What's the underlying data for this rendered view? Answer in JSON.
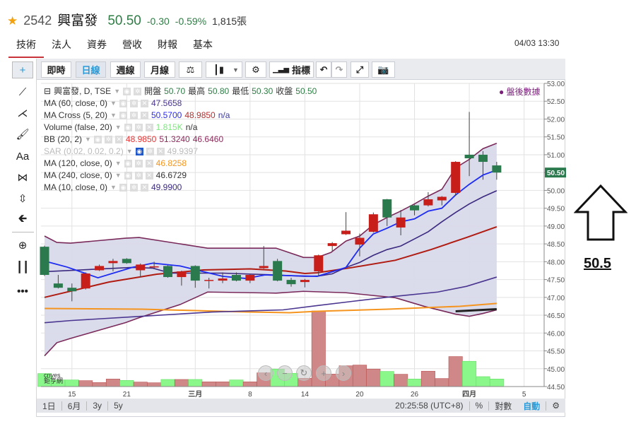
{
  "header": {
    "code": "2542",
    "name": "興富發",
    "price": "50.50",
    "change": "-0.30",
    "change_pct": "-0.59%",
    "volume": "1,815張"
  },
  "tabs": [
    {
      "label": "技術",
      "active": true
    },
    {
      "label": "法人"
    },
    {
      "label": "資券"
    },
    {
      "label": "營收"
    },
    {
      "label": "財報"
    },
    {
      "label": "基本"
    }
  ],
  "datetime": "04/03 13:30",
  "toolbar": {
    "realtime": "即時",
    "daily": "日線",
    "weekly": "週線",
    "monthly": "月線",
    "indicators": "指標"
  },
  "legend": {
    "main": {
      "label": "興富發, D, TSE",
      "open_l": "開盤",
      "open": "50.70",
      "high_l": "最高",
      "high": "50.80",
      "low_l": "最低",
      "low": "50.30",
      "close_l": "收盤",
      "close": "50.50"
    },
    "ma60": {
      "label": "MA (60, close, 0)",
      "v": "47.5658"
    },
    "macross": {
      "label": "MA Cross (5, 20)",
      "v1": "50.5700",
      "v2": "48.9850",
      "v3": "n/a"
    },
    "volume": {
      "label": "Volume (false, 20)",
      "v1": "1.815K",
      "v2": "n/a"
    },
    "bb": {
      "label": "BB (20, 2)",
      "v1": "48.9850",
      "v2": "51.3240",
      "v3": "46.6460"
    },
    "sar": {
      "label": "SAR (0.02, 0.02, 0.2)",
      "v": "49.9397"
    },
    "ma120": {
      "label": "MA (120, close, 0)",
      "v": "46.8258"
    },
    "ma240": {
      "label": "MA (240, close, 0)",
      "v": "46.6729"
    },
    "ma10": {
      "label": "MA (10, close, 0)",
      "v": "49.9900"
    }
  },
  "after_hours": "盤後數據",
  "last_price_tag": "50.50",
  "bottom": {
    "r1": "1日",
    "r2": "6月",
    "r3": "3y",
    "r4": "5y",
    "clock": "20:25:58 (UTC+8)",
    "pct": "%",
    "log": "對數",
    "auto": "自動"
  },
  "annotation": "50.5",
  "colors": {
    "up": "#c81e1a",
    "down": "#2b7a4e",
    "vol_up": "#d08787",
    "vol_down": "#8af78a",
    "ma5": "#1d2cf0",
    "ma20": "#b01c12",
    "ma10": "#3c2a80",
    "ma60": "#4a3590",
    "ma120": "#f5951f",
    "bb": "#7a2a5a",
    "bbfill": "#d8d9ea"
  },
  "chart_data": {
    "type": "candlestick",
    "ylim": [
      44.5,
      53.0
    ],
    "y_ticks": [
      "53.00",
      "52.50",
      "52.00",
      "51.50",
      "51.00",
      "50.50",
      "50.00",
      "49.50",
      "49.00",
      "48.50",
      "48.00",
      "47.50",
      "47.00",
      "46.50",
      "46.00",
      "45.50",
      "45.00",
      "44.50"
    ],
    "x_ticks": [
      {
        "i": 2,
        "label": "15"
      },
      {
        "i": 6,
        "label": "21"
      },
      {
        "i": 11,
        "label": "三月",
        "bold": true
      },
      {
        "i": 15,
        "label": "8"
      },
      {
        "i": 19,
        "label": "14"
      },
      {
        "i": 23,
        "label": "20"
      },
      {
        "i": 27,
        "label": "26"
      },
      {
        "i": 31,
        "label": "四月",
        "bold": true
      },
      {
        "i": 35,
        "label": "5"
      }
    ],
    "candles": [
      [
        48.42,
        48.45,
        47.6,
        47.63
      ],
      [
        47.39,
        47.63,
        47.25,
        47.27
      ],
      [
        47.27,
        47.39,
        46.89,
        47.17
      ],
      [
        47.25,
        47.7,
        47.22,
        47.67
      ],
      [
        47.76,
        47.92,
        47.74,
        47.88
      ],
      [
        47.96,
        48.08,
        47.73,
        48.02
      ],
      [
        48.08,
        48.1,
        47.94,
        47.96
      ],
      [
        47.76,
        47.95,
        47.57,
        47.92
      ],
      [
        47.85,
        48.0,
        47.82,
        47.87
      ],
      [
        47.88,
        47.9,
        47.55,
        47.57
      ],
      [
        47.57,
        47.75,
        47.33,
        47.73
      ],
      [
        47.88,
        47.9,
        47.27,
        47.47
      ],
      [
        47.49,
        47.55,
        47.25,
        47.49
      ],
      [
        47.47,
        47.7,
        47.4,
        47.53
      ],
      [
        47.63,
        47.7,
        47.45,
        47.47
      ],
      [
        47.47,
        47.66,
        47.4,
        47.63
      ],
      [
        47.82,
        48.44,
        47.8,
        47.88
      ],
      [
        48.02,
        48.08,
        47.45,
        47.47
      ],
      [
        47.49,
        47.55,
        47.3,
        47.37
      ],
      [
        47.43,
        47.52,
        47.28,
        47.49
      ],
      [
        47.73,
        48.2,
        47.6,
        48.18
      ],
      [
        48.44,
        48.55,
        48.3,
        48.52
      ],
      [
        48.77,
        49.39,
        48.75,
        48.87
      ],
      [
        48.48,
        48.79,
        48.15,
        48.67
      ],
      [
        48.84,
        49.38,
        48.82,
        49.33
      ],
      [
        49.75,
        49.76,
        49.0,
        49.24
      ],
      [
        48.96,
        49.45,
        48.74,
        49.24
      ],
      [
        49.58,
        49.6,
        49.3,
        49.44
      ],
      [
        49.58,
        49.95,
        49.55,
        49.75
      ],
      [
        49.72,
        49.84,
        49.58,
        49.82
      ],
      [
        49.93,
        50.82,
        49.85,
        50.8
      ],
      [
        51.0,
        52.2,
        50.4,
        50.9
      ],
      [
        51.0,
        51.1,
        50.3,
        50.8
      ],
      [
        50.7,
        50.8,
        50.3,
        50.5
      ]
    ],
    "volume": [
      3120,
      1590,
      1590,
      1420,
      960,
      1810,
      1470,
      1080,
      910,
      1700,
      1700,
      1700,
      1130,
      1130,
      1590,
      1130,
      3290,
      4200,
      3180,
      1980,
      18150,
      3000,
      4990,
      5160,
      4200,
      3630,
      2950,
      1810,
      3690,
      1930,
      7200,
      6070,
      2380,
      1815
    ],
    "lines": {
      "bb_upper": [
        [
          0,
          48.72
        ],
        [
          0.9,
          48.54
        ],
        [
          1.9,
          48.52
        ],
        [
          5.9,
          48.66
        ],
        [
          6.9,
          48.68
        ],
        [
          11.9,
          48.38
        ],
        [
          16.9,
          48.38
        ],
        [
          18.9,
          48.12
        ],
        [
          19.9,
          48.12
        ],
        [
          20.9,
          48.26
        ],
        [
          22,
          48.58
        ],
        [
          23,
          48.72
        ],
        [
          24,
          49.04
        ],
        [
          25,
          49.24
        ],
        [
          26,
          49.42
        ],
        [
          27,
          49.62
        ],
        [
          28,
          49.84
        ],
        [
          29,
          50.03
        ],
        [
          30,
          50.63
        ],
        [
          31,
          50.87
        ],
        [
          32,
          51.17
        ],
        [
          33,
          51.32
        ]
      ],
      "bb_lower": [
        [
          0,
          45.36
        ],
        [
          0.9,
          45.73
        ],
        [
          1.9,
          45.85
        ],
        [
          5.9,
          46.29
        ],
        [
          6.9,
          46.43
        ],
        [
          9.9,
          46.8
        ],
        [
          11.9,
          47.15
        ],
        [
          16.9,
          47.12
        ],
        [
          18.9,
          47.17
        ],
        [
          22,
          47.13
        ],
        [
          25.6,
          46.99
        ],
        [
          27.7,
          46.75
        ],
        [
          30,
          46.53
        ],
        [
          31,
          46.47
        ],
        [
          32,
          46.55
        ],
        [
          33,
          46.65
        ]
      ],
      "ma20": [
        [
          0,
          47.0
        ],
        [
          4.7,
          47.43
        ],
        [
          8.2,
          47.65
        ],
        [
          11.6,
          47.77
        ],
        [
          15,
          47.8
        ],
        [
          17.6,
          47.74
        ],
        [
          19,
          47.67
        ],
        [
          19.9,
          47.69
        ],
        [
          22.5,
          47.84
        ],
        [
          25.6,
          48.04
        ],
        [
          28.2,
          48.34
        ],
        [
          30.8,
          48.68
        ],
        [
          33,
          48.98
        ]
      ],
      "ma5": [
        [
          0,
          48.02
        ],
        [
          1.65,
          47.85
        ],
        [
          3.9,
          47.55
        ],
        [
          6.4,
          47.84
        ],
        [
          7.9,
          47.96
        ],
        [
          9.9,
          47.88
        ],
        [
          13,
          47.59
        ],
        [
          14.7,
          47.53
        ],
        [
          16.1,
          47.63
        ],
        [
          17.8,
          47.61
        ],
        [
          19.9,
          47.59
        ],
        [
          21,
          47.72
        ],
        [
          22,
          47.84
        ],
        [
          23,
          48.38
        ],
        [
          24,
          48.78
        ],
        [
          25,
          48.94
        ],
        [
          26,
          49.12
        ],
        [
          27,
          49.2
        ],
        [
          28,
          49.42
        ],
        [
          29,
          49.5
        ],
        [
          30,
          49.87
        ],
        [
          31,
          50.17
        ],
        [
          32,
          50.43
        ],
        [
          33,
          50.57
        ]
      ],
      "ma10": [
        [
          0,
          47.72
        ],
        [
          6.4,
          47.84
        ],
        [
          7.9,
          47.82
        ],
        [
          9.2,
          47.68
        ],
        [
          13,
          47.68
        ],
        [
          16.8,
          47.63
        ],
        [
          19,
          47.59
        ],
        [
          20,
          47.6
        ],
        [
          21,
          47.66
        ],
        [
          22,
          47.84
        ],
        [
          23,
          47.98
        ],
        [
          24,
          48.18
        ],
        [
          25,
          48.34
        ],
        [
          26,
          48.44
        ],
        [
          27,
          48.64
        ],
        [
          28,
          48.84
        ],
        [
          29,
          49.12
        ],
        [
          30,
          49.38
        ],
        [
          31,
          49.62
        ],
        [
          32,
          49.82
        ],
        [
          33,
          49.99
        ]
      ],
      "ma60": [
        [
          0,
          46.29
        ],
        [
          1.9,
          46.35
        ],
        [
          7.1,
          46.47
        ],
        [
          12.2,
          46.59
        ],
        [
          17.4,
          46.65
        ],
        [
          19.9,
          46.77
        ],
        [
          22.5,
          46.89
        ],
        [
          25.6,
          47.03
        ],
        [
          28.7,
          47.15
        ],
        [
          30.8,
          47.31
        ],
        [
          33,
          47.57
        ]
      ],
      "ma120": [
        [
          0,
          46.69
        ],
        [
          7.1,
          46.67
        ],
        [
          14.8,
          46.59
        ],
        [
          17.9,
          46.57
        ],
        [
          19.9,
          46.61
        ],
        [
          25.1,
          46.67
        ],
        [
          30.3,
          46.75
        ],
        [
          33,
          46.83
        ]
      ],
      "ma240": [
        [
          30,
          46.61
        ],
        [
          33,
          46.67
        ]
      ]
    }
  }
}
